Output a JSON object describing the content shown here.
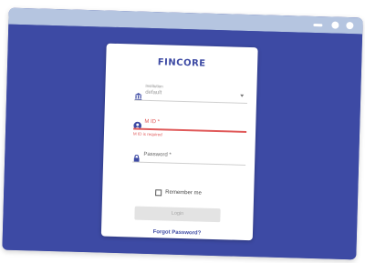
{
  "window": {
    "controls": [
      "minimize",
      "maximize",
      "close"
    ]
  },
  "app": {
    "logo": "FINCORE"
  },
  "form": {
    "institution": {
      "label": "Institution",
      "value": "default",
      "icon": "bank-icon"
    },
    "mid": {
      "placeholder": "M ID *",
      "error": "M ID is required",
      "icon": "user-icon"
    },
    "password": {
      "placeholder": "Password *",
      "icon": "lock-icon"
    },
    "remember_label": "Remember me",
    "login_label": "Login",
    "forgot_label": "Forgot Password?"
  },
  "colors": {
    "brand": "#3d4aa4",
    "error": "#e05a5a",
    "titlebar": "#b5c5e0"
  }
}
